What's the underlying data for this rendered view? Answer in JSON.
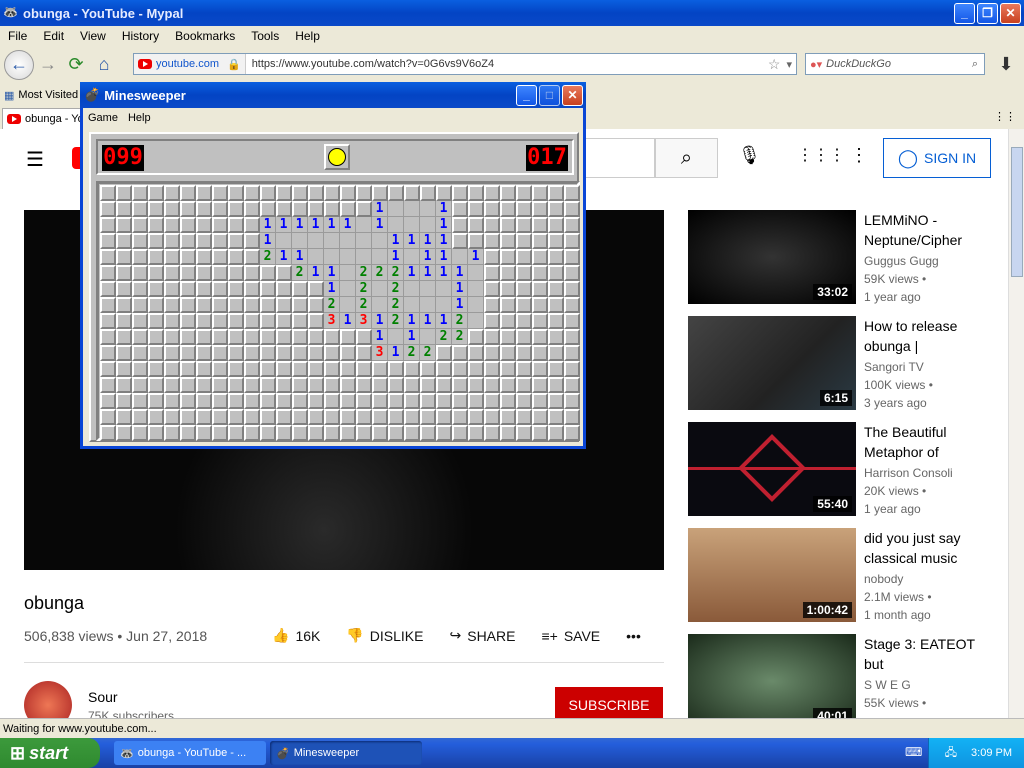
{
  "browser": {
    "title": "obunga - YouTube - Mypal",
    "menu": [
      "File",
      "Edit",
      "View",
      "History",
      "Bookmarks",
      "Tools",
      "Help"
    ],
    "site_label": "youtube.com",
    "url": "https://www.youtube.com/watch?v=0G6vs9V6oZ4",
    "search_placeholder": "DuckDuckGo",
    "bookmark": "Most Visited",
    "tab": "obunga - Yo",
    "status": "Waiting for www.youtube.com..."
  },
  "youtube": {
    "signin": "SIGN IN",
    "video": {
      "title": "obunga",
      "views": "506,838 views • Jun 27, 2018",
      "likes": "16K",
      "dislike": "DISLIKE",
      "share": "SHARE",
      "save": "SAVE"
    },
    "channel": {
      "name": "Sour",
      "subs": "75K subscribers",
      "subscribe": "SUBSCRIBE"
    },
    "recs": [
      {
        "title": "LEMMiNO - Neptune/Cipher",
        "channel": "Guggus Gugg",
        "views": "59K views •",
        "age": "1 year ago",
        "duration": "33:02"
      },
      {
        "title": "How to release obunga |",
        "channel": "Sangori TV",
        "views": "100K views •",
        "age": "3 years ago",
        "duration": "6:15"
      },
      {
        "title": "The Beautiful Metaphor of",
        "channel": "Harrison Consoli",
        "views": "20K views •",
        "age": "1 year ago",
        "duration": "55:40"
      },
      {
        "title": "did you just say classical music",
        "channel": "nobody",
        "views": "2.1M views •",
        "age": "1 month ago",
        "duration": "1:00:42"
      },
      {
        "title": "Stage 3: EATEOT but",
        "channel": "S W E G",
        "views": "55K views •",
        "age": "",
        "duration": "40:01"
      }
    ]
  },
  "minesweeper": {
    "title": "Minesweeper",
    "menu": [
      "Game",
      "Help"
    ],
    "mines_left": "099",
    "timer": "017",
    "rows": [
      "..............................",
      ".................1...1........",
      "..........111111.1...1........",
      "..........1.......1111........",
      "..........211.....1.11.12.....",
      "............211.2221111.......",
      "..............1.2.2...1.......",
      "..............2.2.2...1.......",
      "..............313121112.......",
      ".................1.1.22.......",
      ".................3122.........",
      "..............................",
      "..............................",
      "..............................",
      "..............................",
      ".............................."
    ],
    "open_rows": [
      "..............................",
      ".................@@@@@........",
      "..........@@@@@@@@@@@@........",
      "..........@@@@@@@@@@@@........",
      "..........@@@@@@@@@@@@@@......",
      "............@@@@@@@@@@@@......",
      "..............@@@@@@@@@@......",
      "..............@@@@@@@@@@......",
      "..............@@@@@@@@@@......",
      ".................@@@@@@.......",
      ".................@@@@.........",
      "..............................",
      "..............................",
      "..............................",
      "..............................",
      ".............................."
    ]
  },
  "taskbar": {
    "start": "start",
    "tasks": [
      "obunga - YouTube - ...",
      "Minesweeper"
    ],
    "clock": "3:09 PM"
  }
}
